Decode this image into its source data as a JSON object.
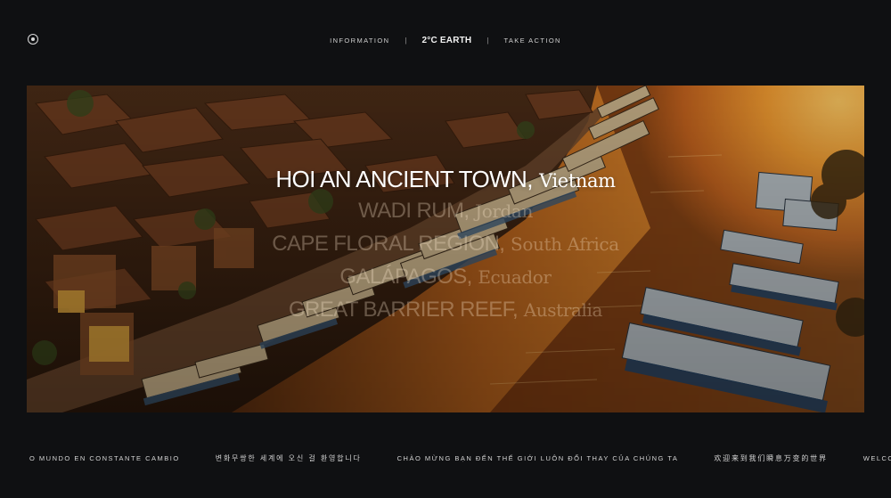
{
  "header": {
    "menu_icon": "menu-dot-icon",
    "nav_left": "INFORMATION",
    "separator": "|",
    "brand_main": "2°C",
    "brand_suffix": "EARTH",
    "nav_right": "TAKE ACTION"
  },
  "hero": {
    "image": "aerial photo of Hoi An river with moored boats at sunset",
    "active": {
      "place": "HOI AN ANCIENT TOWN,",
      "country": "Vietnam"
    },
    "others": [
      {
        "place": "WADI RUM,",
        "country": "Jordan"
      },
      {
        "place": "CAPE FLORAL REGION,",
        "country": "South Africa"
      },
      {
        "place": "GALÁPAGOS,",
        "country": "Ecuador"
      },
      {
        "place": "GREAT BARRIER REEF,",
        "country": "Australia"
      }
    ]
  },
  "ticker": {
    "messages": [
      "O MUNDO EN CONSTANTE CAMBIO",
      "변화무쌍한 세계에 오신 걸 환영합니다",
      "CHÀO MỪNG BẠN ĐẾN THẾ GIỚI LUÔN ĐỔI THAY CỦA CHÚNG TA",
      "欢迎来到我们瞬息万变的世界",
      "WELCOME TO OUR EVER-"
    ]
  },
  "colors": {
    "background": "#0f1012",
    "sunset_glow": "#f2a23a",
    "water": "#c26a1f",
    "text": "#e8e8e8"
  }
}
